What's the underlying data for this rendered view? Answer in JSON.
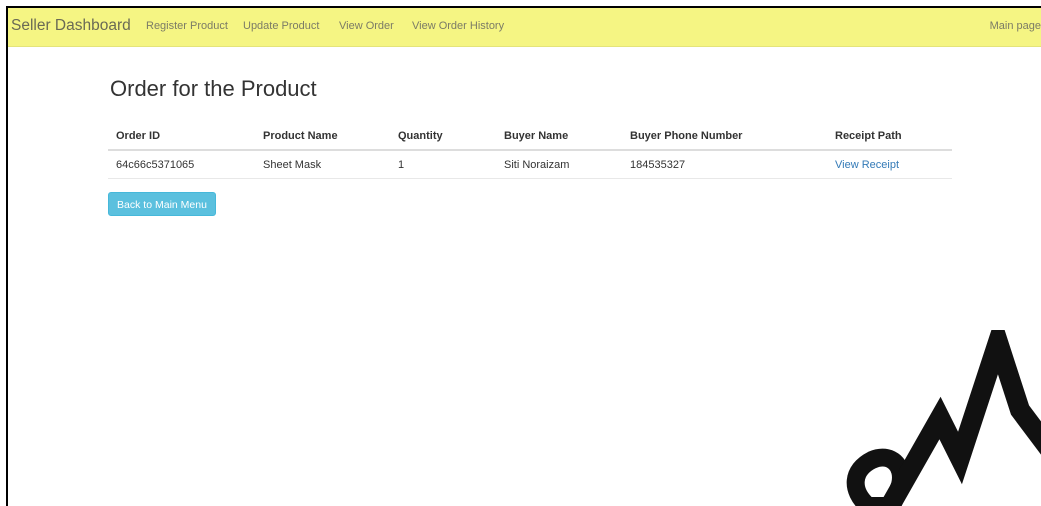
{
  "navbar": {
    "brand": "Seller Dashboard",
    "links": [
      "Register Product",
      "Update Product",
      "View Order",
      "View Order History"
    ],
    "right_link": "Main page"
  },
  "main": {
    "title": "Order for the Product",
    "table": {
      "headers": [
        "Order ID",
        "Product Name",
        "Quantity",
        "Buyer Name",
        "Buyer Phone Number",
        "Receipt Path"
      ],
      "rows": [
        {
          "order_id": "64c66c5371065",
          "product_name": "Sheet Mask",
          "quantity": "1",
          "buyer_name": "Siti Noraizam",
          "buyer_phone": "184535327",
          "receipt_link": "View Receipt"
        }
      ]
    },
    "back_button": "Back to Main Menu"
  },
  "watermark": {
    "text": "SM"
  },
  "colors": {
    "navbar_bg": "#f5f583",
    "button_bg": "#5bc0de",
    "link": "#337ab7"
  }
}
